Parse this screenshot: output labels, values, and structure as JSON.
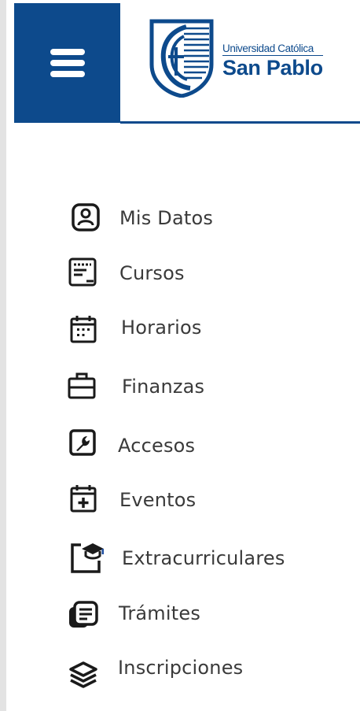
{
  "brand": {
    "university_line": "Universidad Católica",
    "name_line": "San Pablo",
    "primary_color": "#0d4a8c"
  },
  "header": {
    "menu_icon": "hamburger-icon"
  },
  "nav": {
    "items": [
      {
        "label": "Mis Datos",
        "icon": "user-card-icon"
      },
      {
        "label": "Cursos",
        "icon": "course-board-icon"
      },
      {
        "label": "Horarios",
        "icon": "calendar-icon"
      },
      {
        "label": "Finanzas",
        "icon": "briefcase-icon"
      },
      {
        "label": "Accesos",
        "icon": "wrench-icon"
      },
      {
        "label": "Eventos",
        "icon": "calendar-plus-icon"
      },
      {
        "label": "Extracurriculares",
        "icon": "graduation-cap-icon"
      },
      {
        "label": "Trámites",
        "icon": "documents-icon"
      },
      {
        "label": "Inscripciones",
        "icon": "layers-icon"
      }
    ]
  }
}
